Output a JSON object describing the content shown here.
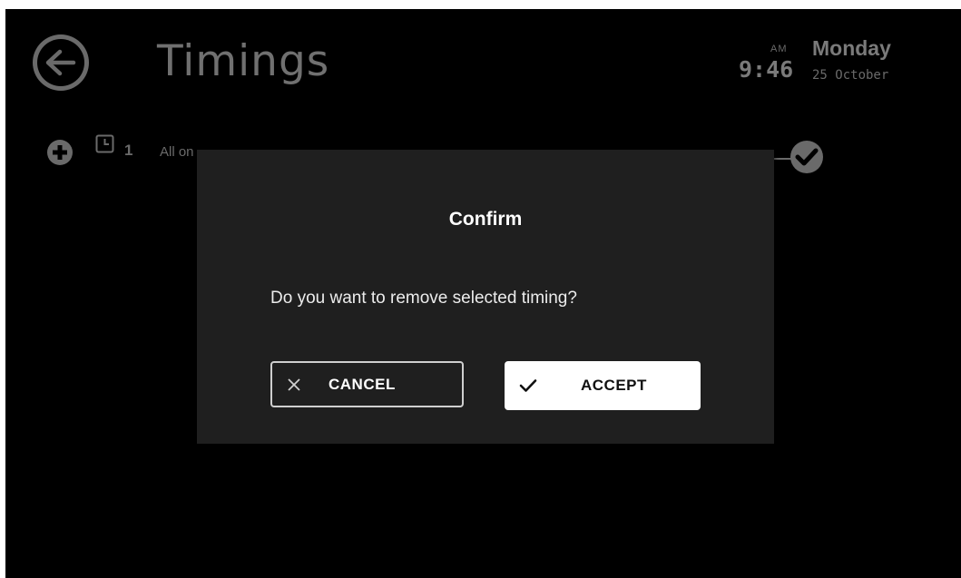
{
  "header": {
    "title": "Timings",
    "time": "9:46",
    "ampm": "AM",
    "day": "Monday",
    "date": "25 October"
  },
  "timing_row": {
    "number": "1",
    "label": "All on",
    "icons": {
      "add": "plus-circle-icon",
      "clock": "clock-icon",
      "status": "check-circle-icon"
    }
  },
  "dialog": {
    "title": "Confirm",
    "message": "Do you want to remove selected timing?",
    "cancel_label": "CANCEL",
    "accept_label": "ACCEPT"
  },
  "colors": {
    "background": "#000000",
    "dialog": "#1f1f1f",
    "muted": "#6a6a6a",
    "accept_bg": "#ffffff"
  }
}
